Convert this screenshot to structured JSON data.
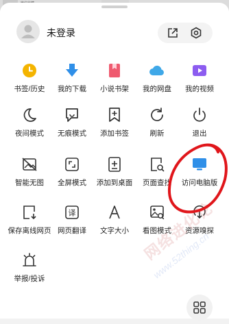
{
  "backdrop": {
    "text": "微信收藏"
  },
  "header": {
    "username": "未登录"
  },
  "menu": [
    {
      "label": "书签/历史",
      "icon": "bookmark-history-icon"
    },
    {
      "label": "我的下载",
      "icon": "download-icon"
    },
    {
      "label": "小说书架",
      "icon": "novel-shelf-icon"
    },
    {
      "label": "我的网盘",
      "icon": "cloud-drive-icon"
    },
    {
      "label": "我的视频",
      "icon": "video-icon"
    },
    {
      "label": "夜间模式",
      "icon": "moon-icon"
    },
    {
      "label": "无痕模式",
      "icon": "incognito-icon"
    },
    {
      "label": "添加书签",
      "icon": "add-bookmark-icon"
    },
    {
      "label": "刷新",
      "icon": "refresh-icon"
    },
    {
      "label": "退出",
      "icon": "power-icon"
    },
    {
      "label": "智能无图",
      "icon": "no-image-icon"
    },
    {
      "label": "全屏模式",
      "icon": "fullscreen-icon"
    },
    {
      "label": "添加到桌面",
      "icon": "add-to-desktop-icon"
    },
    {
      "label": "页面查找",
      "icon": "page-search-icon"
    },
    {
      "label": "访问电脑版",
      "icon": "desktop-version-icon"
    },
    {
      "label": "保存离线网页",
      "icon": "save-offline-icon"
    },
    {
      "label": "网页翻译",
      "icon": "translate-icon"
    },
    {
      "label": "文字大小",
      "icon": "font-size-icon"
    },
    {
      "label": "看图模式",
      "icon": "image-view-icon"
    },
    {
      "label": "资源嗅探",
      "icon": "resource-sniff-icon"
    },
    {
      "label": "举报/投诉",
      "icon": "report-icon"
    }
  ],
  "watermark": {
    "text": "网络进化论",
    "url": "www.52thing.cn"
  },
  "colors": {
    "bookmark": "#f4b400",
    "download": "#2f8fe8",
    "novel": "#ef5a6f",
    "cloud": "#3fa8e8",
    "video": "#8c5cf0",
    "desktop": "#2f8fe8",
    "annotation": "#e0161b"
  }
}
